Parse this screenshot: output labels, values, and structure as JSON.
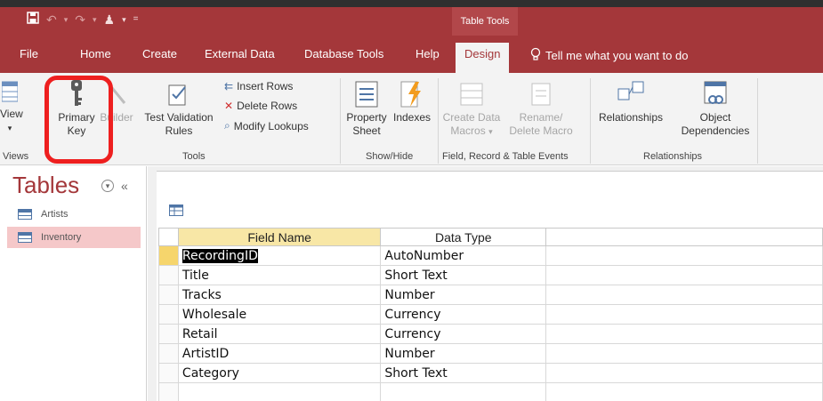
{
  "titlebar": {
    "table_tools": "Table Tools"
  },
  "tabs": [
    {
      "label": "File"
    },
    {
      "label": "Home"
    },
    {
      "label": "Create"
    },
    {
      "label": "External Data"
    },
    {
      "label": "Database Tools"
    },
    {
      "label": "Help"
    },
    {
      "label": "Design"
    }
  ],
  "tell_me": "Tell me what you want to do",
  "ribbon": {
    "view_label": "View",
    "primary_key_line1": "Primary",
    "primary_key_line2": "Key",
    "builder_label": "Builder",
    "test_validation_line1": "Test Validation",
    "test_validation_line2": "Rules",
    "insert_rows": "Insert Rows",
    "delete_rows": "Delete Rows",
    "modify_lookups": "Modify Lookups",
    "property_sheet_line1": "Property",
    "property_sheet_line2": "Sheet",
    "indexes": "Indexes",
    "create_data_macros_line1": "Create Data",
    "create_data_macros_line2": "Macros",
    "rename_delete_line1": "Rename/",
    "rename_delete_line2": "Delete Macro",
    "relationships": "Relationships",
    "object_dep_line1": "Object",
    "object_dep_line2": "Dependencies",
    "groups": {
      "views": "Views",
      "tools": "Tools",
      "show_hide": "Show/Hide",
      "field_events": "Field, Record & Table Events",
      "relationships": "Relationships"
    }
  },
  "nav": {
    "title": "Tables",
    "items": [
      {
        "label": "Artists"
      },
      {
        "label": "Inventory"
      }
    ]
  },
  "grid": {
    "headers": {
      "field_name": "Field Name",
      "data_type": "Data Type"
    },
    "rows": [
      {
        "field": "RecordingID",
        "type": "AutoNumber"
      },
      {
        "field": "Title",
        "type": "Short Text"
      },
      {
        "field": "Tracks",
        "type": "Number"
      },
      {
        "field": "Wholesale",
        "type": "Currency"
      },
      {
        "field": "Retail",
        "type": "Currency"
      },
      {
        "field": "ArtistID",
        "type": "Number"
      },
      {
        "field": "Category",
        "type": "Short Text"
      }
    ]
  },
  "colors": {
    "accent": "#a4373a",
    "highlight_box": "#ee1f1f",
    "selected_nav": "#f5c8c9",
    "field_header": "#f8e7a6"
  }
}
